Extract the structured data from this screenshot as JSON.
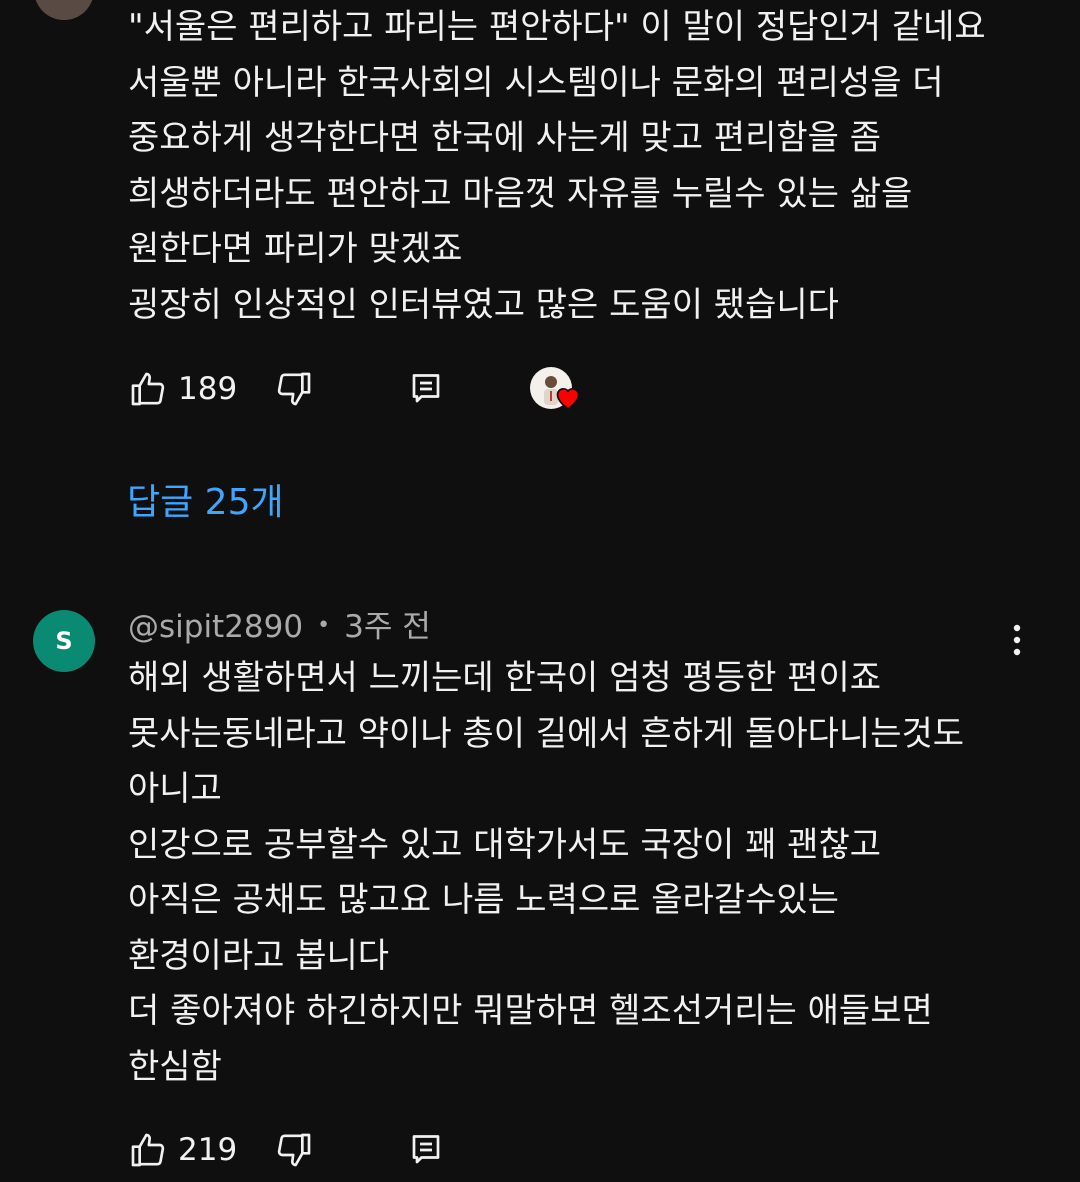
{
  "comment1": {
    "lines": [
      "\"서울은 편리하고 파리는 편안하다\" 이 말이 정답인거 같네요",
      "서울뿐 아니라 한국사회의 시스템이나 문화의 편리성을 더",
      "중요하게 생각한다면 한국에 사는게 맞고 편리함을 좀",
      "희생하더라도 편안하고 마음껏 자유를 누릴수 있는 삶을",
      "원한다면 파리가 맞겠죠",
      "굉장히 인상적인 인터뷰였고 많은 도움이 됐습니다"
    ],
    "like_count": "189",
    "icons": {
      "like": "thumbs-up-icon",
      "dislike": "thumbs-down-icon",
      "reply": "reply-comment-icon",
      "creator_heart": "creator-heart-badge"
    },
    "replies_label": "답글 25개"
  },
  "comment2": {
    "avatar_letter": "S",
    "username": "@sipit2890",
    "separator": "•",
    "timestamp": "3주 전",
    "lines": [
      "해외 생활하면서 느끼는데 한국이 엄청 평등한 편이죠",
      "못사는동네라고 약이나 총이 길에서 흔하게 돌아다니는것도",
      "아니고",
      "인강으로 공부할수 있고 대학가서도 국장이 꽤 괜찮고",
      "아직은 공채도 많고요 나름 노력으로 올라갈수있는",
      "환경이라고 봅니다",
      "더 좋아져야 하긴하지만 뭐말하면 헬조선거리는 애들보면",
      "한심함"
    ],
    "like_count": "219"
  },
  "colors": {
    "background": "#0f0f0f",
    "text": "#f1f1f1",
    "meta": "#aaaaaa",
    "link": "#3ea6ff",
    "avatar_s": "#0b8a73",
    "heart": "#ff0000"
  }
}
